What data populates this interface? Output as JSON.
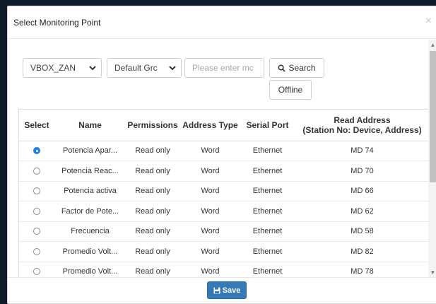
{
  "dialog": {
    "title": "Select Monitoring Point",
    "close_glyph": "×"
  },
  "filters": {
    "device_value": "VBOX_ZAN",
    "group_value": "Default Grc",
    "search_placeholder": "Please enter mc",
    "search_label": "Search",
    "offline_label": "Offline"
  },
  "table": {
    "headers": {
      "select": "Select",
      "name": "Name",
      "permissions": "Permissions",
      "address_type": "Address Type",
      "serial_port": "Serial Port",
      "read_address_line1": "Read Address",
      "read_address_line2": "(Station No: Device, Address)"
    },
    "rows": [
      {
        "selected": true,
        "name": "Potencia Apar...",
        "permissions": "Read only",
        "address_type": "Word",
        "serial_port": "Ethernet",
        "read_address": "MD 74"
      },
      {
        "selected": false,
        "name": "Potencia Reac...",
        "permissions": "Read only",
        "address_type": "Word",
        "serial_port": "Ethernet",
        "read_address": "MD 70"
      },
      {
        "selected": false,
        "name": "Potencia activa",
        "permissions": "Read only",
        "address_type": "Word",
        "serial_port": "Ethernet",
        "read_address": "MD 66"
      },
      {
        "selected": false,
        "name": "Factor de Pote...",
        "permissions": "Read only",
        "address_type": "Word",
        "serial_port": "Ethernet",
        "read_address": "MD 62"
      },
      {
        "selected": false,
        "name": "Frecuencia",
        "permissions": "Read only",
        "address_type": "Word",
        "serial_port": "Ethernet",
        "read_address": "MD 58"
      },
      {
        "selected": false,
        "name": "Promedio Volt...",
        "permissions": "Read only",
        "address_type": "Word",
        "serial_port": "Ethernet",
        "read_address": "MD 82"
      },
      {
        "selected": false,
        "name": "Promedio Volt...",
        "permissions": "Read only",
        "address_type": "Word",
        "serial_port": "Ethernet",
        "read_address": "MD 78"
      }
    ]
  },
  "footer": {
    "save_label": "Save"
  },
  "colors": {
    "primary": "#337ab7",
    "radio_checked": "#1e7ee6"
  }
}
